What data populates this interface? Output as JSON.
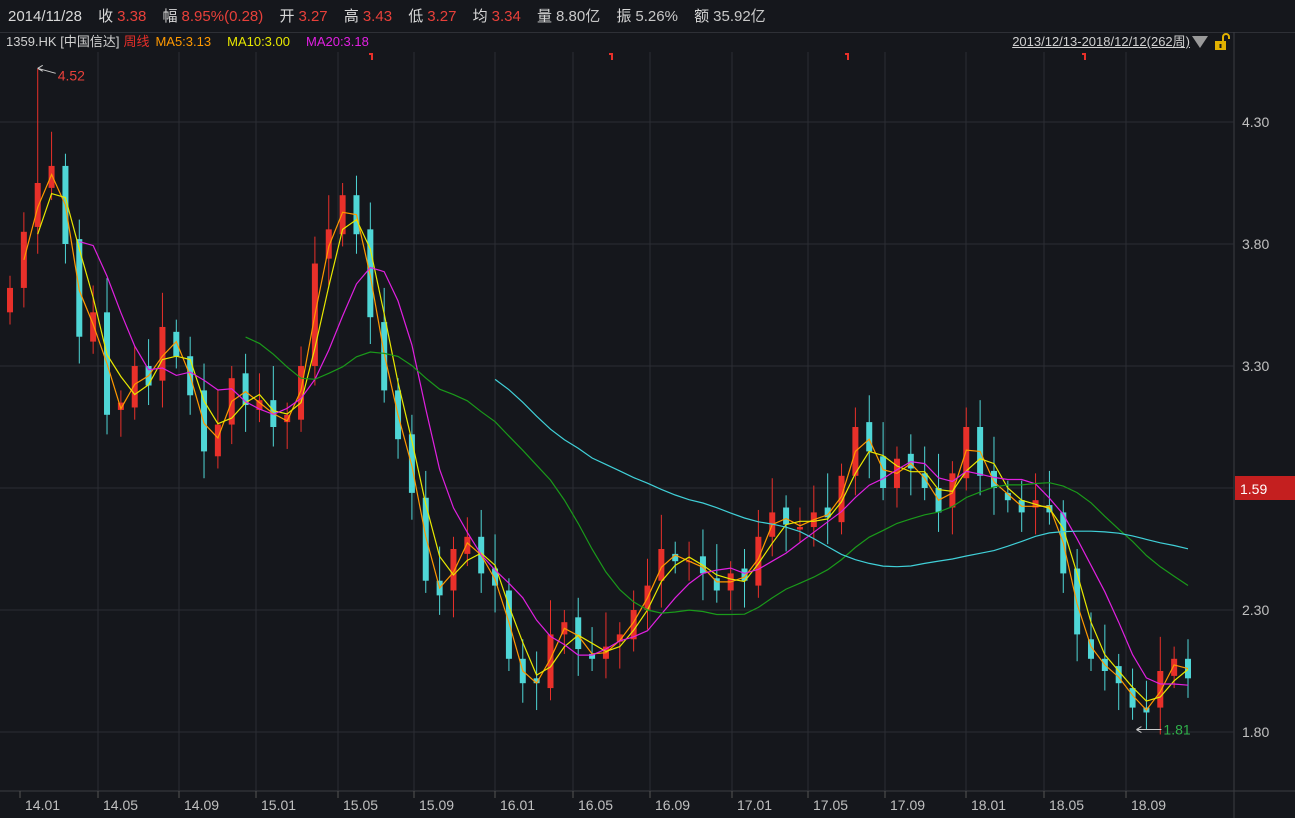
{
  "header": {
    "date": "2014/11/28",
    "close_label": "收",
    "close": "3.38",
    "change_label": "幅",
    "change": "8.95%(0.28)",
    "open_label": "开",
    "open": "3.27",
    "high_label": "高",
    "high": "3.43",
    "low_label": "低",
    "low": "3.27",
    "avg_label": "均",
    "avg": "3.34",
    "volume_label": "量",
    "volume": "8.80亿",
    "amplitude_label": "振",
    "amplitude": "5.26%",
    "amount_label": "额",
    "amount": "35.92亿"
  },
  "legend": {
    "symbol": "1359.HK [中国信达]",
    "period": "周线",
    "ma5": "MA5:3.13",
    "ma10": "MA10:3.00",
    "ma20": "MA20:3.18",
    "range": "2013/12/13-2018/12/12(262周)"
  },
  "colors": {
    "up": "#e8302a",
    "down": "#4fd6d6",
    "ma5": "#ff9900",
    "ma10": "#e8e800",
    "ma20": "#e020e0",
    "ma60": "#1a9a1a",
    "ma120": "#40d0d8",
    "grid": "#2c2e34"
  },
  "chart_data": {
    "type": "candlestick",
    "title": "1359.HK 中国信达 周线",
    "ylim": [
      1.6,
      4.6
    ],
    "yticks": [
      "4.30",
      "3.80",
      "3.30",
      "2.30",
      "1.80"
    ],
    "current_price_badge": "1.59",
    "xticks": [
      "14.01",
      "14.05",
      "14.09",
      "15.01",
      "15.05",
      "15.09",
      "16.01",
      "16.05",
      "16.09",
      "17.01",
      "17.05",
      "17.09",
      "18.01",
      "18.05",
      "18.09"
    ],
    "close": [
      3.62,
      3.85,
      4.05,
      4.12,
      3.8,
      3.42,
      3.52,
      3.1,
      3.15,
      3.3,
      3.22,
      3.46,
      3.34,
      3.18,
      2.95,
      3.06,
      3.25,
      3.14,
      3.16,
      3.05,
      3.1,
      3.3,
      3.72,
      3.86,
      4.0,
      3.84,
      3.5,
      3.2,
      3.0,
      2.78,
      2.42,
      2.36,
      2.55,
      2.6,
      2.45,
      2.4,
      2.1,
      2.0,
      2.0,
      2.2,
      2.25,
      2.14,
      2.1,
      2.15,
      2.2,
      2.3,
      2.4,
      2.55,
      2.5,
      2.5,
      2.45,
      2.38,
      2.45,
      2.42,
      2.6,
      2.7,
      2.65,
      2.64,
      2.7,
      2.68,
      2.85,
      3.05,
      2.95,
      2.8,
      2.92,
      2.88,
      2.8,
      2.7,
      2.86,
      3.05,
      2.85,
      2.8,
      2.75,
      2.7,
      2.75,
      2.7,
      2.45,
      2.2,
      2.1,
      2.05,
      2.0,
      1.9,
      1.88,
      2.05,
      2.1,
      2.02
    ],
    "ma_periods": {
      "ma5": 2,
      "ma10": 3,
      "ma20": 6,
      "ma60": 18,
      "ma120": 36
    },
    "max_label": "4.52",
    "max_index": 2,
    "min_label": "1.81",
    "min_index": 82
  }
}
